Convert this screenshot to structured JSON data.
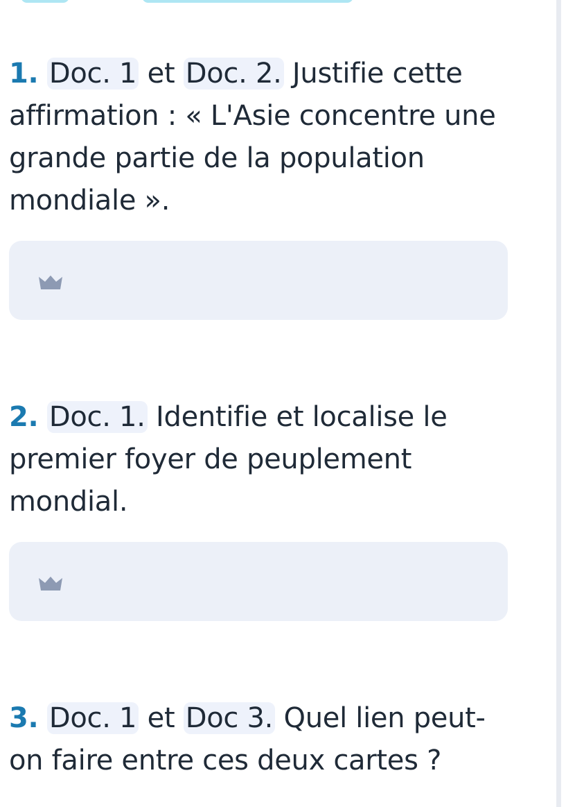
{
  "questions": [
    {
      "number": "1.",
      "parts": [
        {
          "text": "Doc. 1",
          "doc": true
        },
        {
          "text": " et ",
          "doc": false
        },
        {
          "text": "Doc. 2.",
          "doc": true
        },
        {
          "text": " Justifie cette affirmation : « L'Asie concentre une grande partie de la population mondiale ».",
          "doc": false
        }
      ],
      "has_answer_box": true
    },
    {
      "number": "2.",
      "parts": [
        {
          "text": "Doc. 1.",
          "doc": true
        },
        {
          "text": " Identifie et localise le premier foyer de peuplement mondial.",
          "doc": false
        }
      ],
      "has_answer_box": true
    },
    {
      "number": "3.",
      "parts": [
        {
          "text": "Doc. 1",
          "doc": true
        },
        {
          "text": " et ",
          "doc": false
        },
        {
          "text": "Doc 3.",
          "doc": true
        },
        {
          "text": " Quel lien peut-on faire entre ces deux cartes ?",
          "doc": false
        }
      ],
      "has_answer_box": false
    }
  ],
  "answer_icon": "crown-icon",
  "colors": {
    "question_number": "#1b7ab0",
    "doc_highlight": "#eef2fb",
    "answer_box": "#ecf0f8",
    "icon": "#8d9ab3",
    "top_shape": "#aee6f3"
  }
}
